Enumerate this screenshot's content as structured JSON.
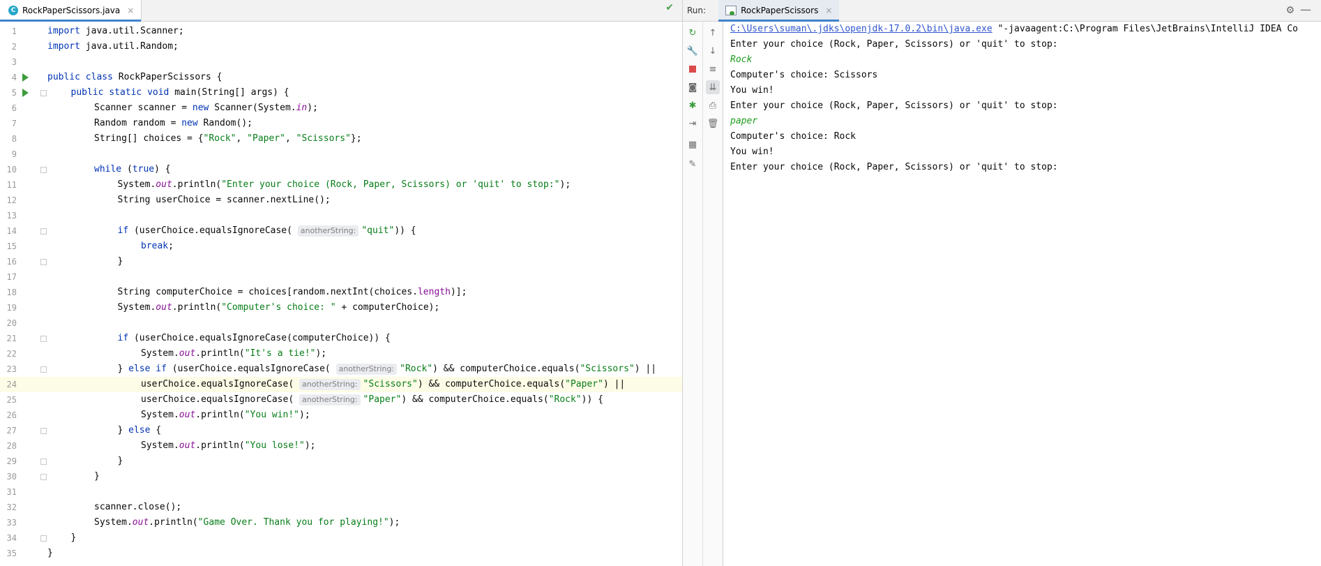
{
  "editor": {
    "tab_label": "RockPaperScissors.java",
    "tab_icon": "c-class-icon",
    "close_glyph": "×"
  },
  "run": {
    "label": "Run:",
    "tab_label": "RockPaperScissors",
    "path_link": "C:\\Users\\suman\\.jdks\\openjdk-17.0.2\\bin\\java.exe",
    "path_rest": " \"-javaagent:C:\\Program Files\\JetBrains\\IntelliJ IDEA Co",
    "console": [
      {
        "text": "Enter your choice (Rock, Paper, Scissors) or 'quit' to stop:",
        "type": "out"
      },
      {
        "text": "Rock",
        "type": "in"
      },
      {
        "text": "Computer's choice: Scissors",
        "type": "out"
      },
      {
        "text": "You win!",
        "type": "out"
      },
      {
        "text": "Enter your choice (Rock, Paper, Scissors) or 'quit' to stop:",
        "type": "out"
      },
      {
        "text": "paper",
        "type": "in"
      },
      {
        "text": "Computer's choice: Rock",
        "type": "out"
      },
      {
        "text": "You win!",
        "type": "out"
      },
      {
        "text": "Enter your choice (Rock, Paper, Scissors) or 'quit' to stop:",
        "type": "out"
      }
    ]
  },
  "code": [
    {
      "n": "1",
      "ind": 0,
      "t": [
        [
          "kw",
          "import"
        ],
        [
          "",
          "java.util.Scanner;"
        ]
      ]
    },
    {
      "n": "2",
      "ind": 0,
      "t": [
        [
          "kw",
          "import"
        ],
        [
          "",
          "java.util.Random;"
        ]
      ]
    },
    {
      "n": "3",
      "ind": 0,
      "t": []
    },
    {
      "n": "4",
      "ind": 0,
      "run": true,
      "t": [
        [
          "kw",
          "public class"
        ],
        [
          "",
          " RockPaperScissors {"
        ]
      ]
    },
    {
      "n": "5",
      "ind": 1,
      "run": true,
      "fold": true,
      "t": [
        [
          "kw",
          "public static void"
        ],
        [
          "",
          " main(String[] args) {"
        ]
      ]
    },
    {
      "n": "6",
      "ind": 2,
      "t": [
        [
          "",
          "Scanner scanner = "
        ],
        [
          "kw",
          "new"
        ],
        [
          "",
          " Scanner(System."
        ],
        [
          "fld",
          "in"
        ],
        [
          "",
          ");"
        ]
      ]
    },
    {
      "n": "7",
      "ind": 2,
      "t": [
        [
          "",
          "Random random = "
        ],
        [
          "kw",
          "new"
        ],
        [
          "",
          " Random();"
        ]
      ]
    },
    {
      "n": "8",
      "ind": 2,
      "t": [
        [
          "",
          "String[] choices = {"
        ],
        [
          "str",
          "\"Rock\""
        ],
        [
          "",
          ", "
        ],
        [
          "str",
          "\"Paper\""
        ],
        [
          "",
          ", "
        ],
        [
          "str",
          "\"Scissors\""
        ],
        [
          "",
          "};"
        ]
      ]
    },
    {
      "n": "9",
      "ind": 0,
      "t": []
    },
    {
      "n": "10",
      "ind": 2,
      "fold": true,
      "t": [
        [
          "kw",
          "while"
        ],
        [
          "",
          " ("
        ],
        [
          "kw",
          "true"
        ],
        [
          "",
          ") {"
        ]
      ]
    },
    {
      "n": "11",
      "ind": 3,
      "t": [
        [
          "",
          "System."
        ],
        [
          "fld",
          "out"
        ],
        [
          "",
          ".println("
        ],
        [
          "str",
          "\"Enter your choice (Rock, Paper, Scissors) or 'quit' to stop:\""
        ],
        [
          "",
          ");"
        ]
      ]
    },
    {
      "n": "12",
      "ind": 3,
      "t": [
        [
          "",
          "String userChoice = scanner.nextLine();"
        ]
      ]
    },
    {
      "n": "13",
      "ind": 0,
      "t": []
    },
    {
      "n": "14",
      "ind": 3,
      "fold": true,
      "t": [
        [
          "kw",
          "if"
        ],
        [
          "",
          " (userChoice.equalsIgnoreCase( "
        ],
        [
          "hint",
          "anotherString:"
        ],
        [
          "str",
          "\"quit\""
        ],
        [
          "",
          ")) {"
        ]
      ]
    },
    {
      "n": "15",
      "ind": 4,
      "t": [
        [
          "kw",
          "break"
        ],
        [
          "",
          ";"
        ]
      ]
    },
    {
      "n": "16",
      "ind": 3,
      "fold": true,
      "t": [
        [
          "",
          "}"
        ]
      ]
    },
    {
      "n": "17",
      "ind": 0,
      "t": []
    },
    {
      "n": "18",
      "ind": 3,
      "t": [
        [
          "",
          "String computerChoice = choices[random.nextInt(choices."
        ],
        [
          "mfld",
          "length"
        ],
        [
          "",
          ")];"
        ]
      ]
    },
    {
      "n": "19",
      "ind": 3,
      "t": [
        [
          "",
          "System."
        ],
        [
          "fld",
          "out"
        ],
        [
          "",
          ".println("
        ],
        [
          "str",
          "\"Computer's choice: \""
        ],
        [
          "",
          " + computerChoice);"
        ]
      ]
    },
    {
      "n": "20",
      "ind": 0,
      "t": []
    },
    {
      "n": "21",
      "ind": 3,
      "fold": true,
      "t": [
        [
          "kw",
          "if"
        ],
        [
          "",
          " (userChoice.equalsIgnoreCase(computerChoice)) {"
        ]
      ]
    },
    {
      "n": "22",
      "ind": 4,
      "t": [
        [
          "",
          "System."
        ],
        [
          "fld",
          "out"
        ],
        [
          "",
          ".println("
        ],
        [
          "str",
          "\"It's a tie!\""
        ],
        [
          "",
          ");"
        ]
      ]
    },
    {
      "n": "23",
      "ind": 3,
      "fold": true,
      "t": [
        [
          "",
          "} "
        ],
        [
          "kw",
          "else if"
        ],
        [
          "",
          " (userChoice.equalsIgnoreCase( "
        ],
        [
          "hint",
          "anotherString:"
        ],
        [
          "str",
          "\"Rock\""
        ],
        [
          "",
          ") && computerChoice.equals("
        ],
        [
          "str",
          "\"Scissors\""
        ],
        [
          "",
          ") ||"
        ]
      ]
    },
    {
      "n": "24",
      "ind": 4,
      "cur": true,
      "t": [
        [
          "",
          "userChoice.equalsIgnoreCase( "
        ],
        [
          "hint",
          "anotherString:"
        ],
        [
          "str",
          "\"Scissors\""
        ],
        [
          "",
          ") && computerChoice.equals("
        ],
        [
          "str",
          "\"Paper\""
        ],
        [
          "",
          ") ||"
        ]
      ]
    },
    {
      "n": "25",
      "ind": 4,
      "t": [
        [
          "",
          "userChoice.equalsIgnoreCase( "
        ],
        [
          "hint",
          "anotherString:"
        ],
        [
          "str",
          "\"Paper\""
        ],
        [
          "",
          ") && computerChoice.equals("
        ],
        [
          "str",
          "\"Rock\""
        ],
        [
          "",
          ")) {"
        ]
      ]
    },
    {
      "n": "26",
      "ind": 4,
      "t": [
        [
          "",
          "System."
        ],
        [
          "fld",
          "out"
        ],
        [
          "",
          ".println("
        ],
        [
          "str",
          "\"You win!\""
        ],
        [
          "",
          ");"
        ]
      ]
    },
    {
      "n": "27",
      "ind": 3,
      "fold": true,
      "t": [
        [
          "",
          "} "
        ],
        [
          "kw",
          "else"
        ],
        [
          "",
          " {"
        ]
      ]
    },
    {
      "n": "28",
      "ind": 4,
      "t": [
        [
          "",
          "System."
        ],
        [
          "fld",
          "out"
        ],
        [
          "",
          ".println("
        ],
        [
          "str",
          "\"You lose!\""
        ],
        [
          "",
          ");"
        ]
      ]
    },
    {
      "n": "29",
      "ind": 3,
      "fold": true,
      "t": [
        [
          "",
          "}"
        ]
      ]
    },
    {
      "n": "30",
      "ind": 2,
      "fold": true,
      "t": [
        [
          "",
          "}"
        ]
      ]
    },
    {
      "n": "31",
      "ind": 0,
      "t": []
    },
    {
      "n": "32",
      "ind": 2,
      "t": [
        [
          "",
          "scanner.close();"
        ]
      ]
    },
    {
      "n": "33",
      "ind": 2,
      "t": [
        [
          "",
          "System."
        ],
        [
          "fld",
          "out"
        ],
        [
          "",
          ".println("
        ],
        [
          "str",
          "\"Game Over. Thank you for playing!\""
        ],
        [
          "",
          ");"
        ]
      ]
    },
    {
      "n": "34",
      "ind": 1,
      "fold": true,
      "t": [
        [
          "",
          "}"
        ]
      ]
    },
    {
      "n": "35",
      "ind": 0,
      "t": [
        [
          "",
          "}"
        ]
      ]
    }
  ]
}
